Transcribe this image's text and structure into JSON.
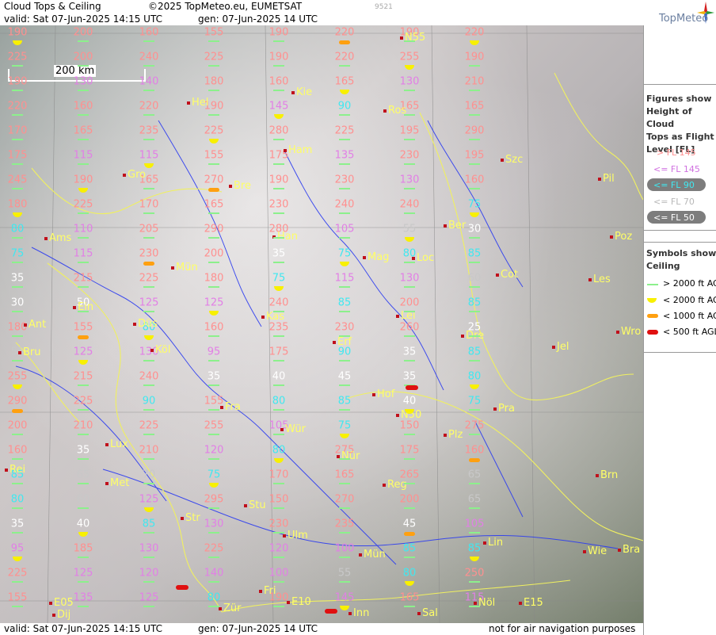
{
  "header": {
    "title": "Cloud Tops & Ceiling",
    "copyright": "©2025 TopMeteo.eu, EUMETSAT",
    "valid": "valid:  Sat  07-Jun-2025  14:15 UTC",
    "gen": "gen: 07-Jun-2025 14 UTC",
    "code": "9521",
    "brand": "TopMeteo"
  },
  "footer": {
    "valid": "valid:  Sat  07-Jun-2025  14:15 UTC",
    "gen": "gen: 07-Jun-2025 14 UTC",
    "note": "not for air navigation purposes"
  },
  "scale_label": "200 km",
  "legend": {
    "tops_heading": [
      "Figures show",
      "Height of Cloud",
      "Tops as Flight",
      "Level  [FL]"
    ],
    "tops_rows": [
      "> FL 145",
      "<= FL 145",
      "<= FL 90",
      "<= FL 70",
      "<= FL 50"
    ],
    "ceiling_heading": [
      "Symbols show",
      "Ceiling"
    ],
    "ceiling_rows": [
      "> 2000 ft AGL",
      "< 2000 ft AGL",
      "< 1000 ft AGL",
      "< 500 ft AGL"
    ]
  },
  "colors": {
    "above_145": "#ff9090",
    "le_145": "#e27fe6",
    "le_90": "#40e8f0",
    "le_70": "#c8c8c8",
    "le_50": "#ffffff",
    "ceiling_high": "#8cf08c",
    "ceiling_2000": "#f8f000",
    "ceiling_1000": "#ffa010",
    "ceiling_500": "#e01010"
  },
  "cities": [
    "Kie",
    "Hel",
    "Ros",
    "Szc",
    "Pil",
    "Gro",
    "Bre",
    "Ham",
    "Ams",
    "Han",
    "Ber",
    "Poz",
    "Mag",
    "Loc",
    "Cot",
    "Les",
    "Mün",
    "Ein",
    "Kas",
    "Lei",
    "Ant",
    "Düs",
    "Erf",
    "Dre",
    "Wro",
    "Bru",
    "Köl",
    "Jel",
    "Hof",
    "Fra",
    "Pra",
    "N50",
    "Lux",
    "Wür",
    "Plz",
    "Rei",
    "Met",
    "Nür",
    "Reg",
    "Brn",
    "Stu",
    "Str",
    "Ulm",
    "Lin",
    "Mün",
    "Wie",
    "Bra",
    "Fri",
    "E10",
    "Inn",
    "Sal",
    "Nöl",
    "E15",
    "E05",
    "Dij",
    "Zür",
    "N55"
  ],
  "tops": [
    [
      "190",
      "red"
    ],
    [
      "200",
      "red"
    ],
    [
      "160",
      "red"
    ],
    [
      "155",
      "red"
    ],
    [
      "190",
      "red"
    ],
    [
      "220",
      "red"
    ],
    [
      "190",
      "red"
    ],
    [
      "220",
      "red"
    ],
    [
      "225",
      "red"
    ],
    [
      "200",
      "red"
    ],
    [
      "240",
      "red"
    ],
    [
      "225",
      "red"
    ],
    [
      "190",
      "red"
    ],
    [
      "220",
      "red"
    ],
    [
      "255",
      "red"
    ],
    [
      "190",
      "red"
    ],
    [
      "190",
      "red"
    ],
    [
      "130",
      "pink"
    ],
    [
      "140",
      "pink"
    ],
    [
      "180",
      "red"
    ],
    [
      "160",
      "red"
    ],
    [
      "165",
      "red"
    ],
    [
      "130",
      "pink"
    ],
    [
      "210",
      "red"
    ],
    [
      "220",
      "red"
    ],
    [
      "160",
      "red"
    ],
    [
      "220",
      "red"
    ],
    [
      "190",
      "red"
    ],
    [
      "145",
      "pink"
    ],
    [
      "90",
      "cyan"
    ],
    [
      "165",
      "red"
    ],
    [
      "165",
      "red"
    ],
    [
      "170",
      "red"
    ],
    [
      "165",
      "red"
    ],
    [
      "235",
      "red"
    ],
    [
      "225",
      "red"
    ],
    [
      "280",
      "red"
    ],
    [
      "225",
      "red"
    ],
    [
      "195",
      "red"
    ],
    [
      "290",
      "red"
    ],
    [
      "175",
      "red"
    ],
    [
      "115",
      "pink"
    ],
    [
      "115",
      "pink"
    ],
    [
      "155",
      "red"
    ],
    [
      "175",
      "red"
    ],
    [
      "135",
      "pink"
    ],
    [
      "230",
      "red"
    ],
    [
      "195",
      "red"
    ],
    [
      "245",
      "red"
    ],
    [
      "190",
      "red"
    ],
    [
      "165",
      "red"
    ],
    [
      "270",
      "red"
    ],
    [
      "190",
      "red"
    ],
    [
      "230",
      "red"
    ],
    [
      "130",
      "pink"
    ],
    [
      "160",
      "red"
    ],
    [
      "180",
      "red"
    ],
    [
      "225",
      "red"
    ],
    [
      "170",
      "red"
    ],
    [
      "165",
      "red"
    ],
    [
      "230",
      "red"
    ],
    [
      "240",
      "red"
    ],
    [
      "240",
      "red"
    ],
    [
      "75",
      "cyan"
    ],
    [
      "80",
      "cyan"
    ],
    [
      "110",
      "pink"
    ],
    [
      "205",
      "red"
    ],
    [
      "290",
      "red"
    ],
    [
      "280",
      "red"
    ],
    [
      "105",
      "pink"
    ],
    [
      "55",
      "gray"
    ],
    [
      "30",
      "white"
    ],
    [
      "75",
      "cyan"
    ],
    [
      "115",
      "pink"
    ],
    [
      "230",
      "red"
    ],
    [
      "200",
      "red"
    ],
    [
      "35",
      "white"
    ],
    [
      "75",
      "cyan"
    ],
    [
      "80",
      "cyan"
    ],
    [
      "85",
      "cyan"
    ],
    [
      "35",
      "white"
    ],
    [
      "215",
      "red"
    ],
    [
      "225",
      "red"
    ],
    [
      "180",
      "red"
    ],
    [
      "75",
      "cyan"
    ],
    [
      "115",
      "pink"
    ],
    [
      "130",
      "pink"
    ],
    [
      "60",
      "gray"
    ],
    [
      "30",
      "white"
    ],
    [
      "50",
      "white"
    ],
    [
      "125",
      "pink"
    ],
    [
      "125",
      "pink"
    ],
    [
      "240",
      "red"
    ],
    [
      "85",
      "cyan"
    ],
    [
      "200",
      "red"
    ],
    [
      "85",
      "cyan"
    ],
    [
      "180",
      "red"
    ],
    [
      "155",
      "red"
    ],
    [
      "80",
      "cyan"
    ],
    [
      "160",
      "red"
    ],
    [
      "235",
      "red"
    ],
    [
      "230",
      "red"
    ],
    [
      "260",
      "red"
    ],
    [
      "25",
      "white"
    ],
    [
      "55",
      "gray"
    ],
    [
      "125",
      "pink"
    ],
    [
      "130",
      "pink"
    ],
    [
      "95",
      "pink"
    ],
    [
      "175",
      "red"
    ],
    [
      "90",
      "cyan"
    ],
    [
      "35",
      "white"
    ],
    [
      "85",
      "cyan"
    ],
    [
      "255",
      "red"
    ],
    [
      "215",
      "red"
    ],
    [
      "240",
      "red"
    ],
    [
      "35",
      "white"
    ],
    [
      "40",
      "white"
    ],
    [
      "45",
      "white"
    ],
    [
      "35",
      "white"
    ],
    [
      "80",
      "cyan"
    ],
    [
      "290",
      "red"
    ],
    [
      "225",
      "red"
    ],
    [
      "90",
      "cyan"
    ],
    [
      "155",
      "red"
    ],
    [
      "80",
      "cyan"
    ],
    [
      "85",
      "cyan"
    ],
    [
      "40",
      "white"
    ],
    [
      "75",
      "cyan"
    ],
    [
      "200",
      "red"
    ],
    [
      "210",
      "red"
    ],
    [
      "225",
      "red"
    ],
    [
      "255",
      "red"
    ],
    [
      "105",
      "pink"
    ],
    [
      "75",
      "cyan"
    ],
    [
      "150",
      "red"
    ],
    [
      "275",
      "red"
    ],
    [
      "160",
      "red"
    ],
    [
      "35",
      "white"
    ],
    [
      "210",
      "red"
    ],
    [
      "120",
      "pink"
    ],
    [
      "80",
      "cyan"
    ],
    [
      "275",
      "red"
    ],
    [
      "175",
      "red"
    ],
    [
      "160",
      "red"
    ],
    [
      "85",
      "cyan"
    ],
    [
      "65",
      "gray"
    ],
    [
      "70",
      "gray"
    ],
    [
      "75",
      "cyan"
    ],
    [
      "170",
      "red"
    ],
    [
      "165",
      "red"
    ],
    [
      "265",
      "red"
    ],
    [
      "65",
      "gray"
    ],
    [
      "80",
      "cyan"
    ],
    [
      "60",
      "gray"
    ],
    [
      "125",
      "pink"
    ],
    [
      "295",
      "red"
    ],
    [
      "150",
      "red"
    ],
    [
      "270",
      "red"
    ],
    [
      "200",
      "red"
    ],
    [
      "65",
      "gray"
    ],
    [
      "35",
      "white"
    ],
    [
      "40",
      "white"
    ],
    [
      "85",
      "cyan"
    ],
    [
      "130",
      "pink"
    ],
    [
      "230",
      "red"
    ],
    [
      "235",
      "red"
    ],
    [
      "45",
      "white"
    ],
    [
      "105",
      "pink"
    ],
    [
      "95",
      "pink"
    ],
    [
      "185",
      "red"
    ],
    [
      "130",
      "pink"
    ],
    [
      "225",
      "red"
    ],
    [
      "120",
      "pink"
    ],
    [
      "100",
      "pink"
    ],
    [
      "85",
      "cyan"
    ],
    [
      "85",
      "cyan"
    ],
    [
      "225",
      "red"
    ],
    [
      "125",
      "pink"
    ],
    [
      "120",
      "pink"
    ],
    [
      "140",
      "pink"
    ],
    [
      "100",
      "pink"
    ],
    [
      "55",
      "gray"
    ],
    [
      "80",
      "cyan"
    ],
    [
      "250",
      "red"
    ],
    [
      "155",
      "red"
    ],
    [
      "135",
      "pink"
    ],
    [
      "125",
      "pink"
    ],
    [
      "80",
      "cyan"
    ],
    [
      "190",
      "red"
    ],
    [
      "145",
      "pink"
    ],
    [
      "165",
      "red"
    ],
    [
      "115",
      "pink"
    ]
  ]
}
